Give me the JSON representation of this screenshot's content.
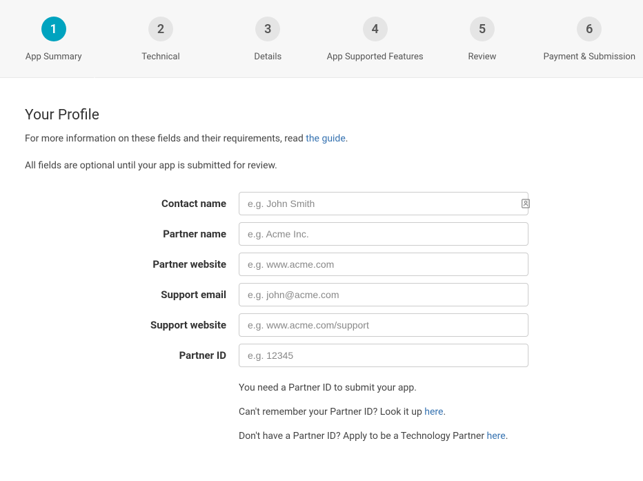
{
  "stepper": {
    "steps": [
      {
        "num": "1",
        "label": "App Summary",
        "active": true
      },
      {
        "num": "2",
        "label": "Technical",
        "active": false
      },
      {
        "num": "3",
        "label": "Details",
        "active": false
      },
      {
        "num": "4",
        "label": "App Supported Features",
        "active": false
      },
      {
        "num": "5",
        "label": "Review",
        "active": false
      },
      {
        "num": "6",
        "label": "Payment & Submission",
        "active": false
      }
    ]
  },
  "section": {
    "title": "Your Profile",
    "desc_prefix": "For more information on these fields and their requirements, read ",
    "desc_link": "the guide",
    "desc_suffix": ".",
    "note": "All fields are optional until your app is submitted for review."
  },
  "fields": {
    "contact_name": {
      "label": "Contact name",
      "placeholder": "e.g. John Smith"
    },
    "partner_name": {
      "label": "Partner name",
      "placeholder": "e.g. Acme Inc."
    },
    "partner_website": {
      "label": "Partner website",
      "placeholder": "e.g. www.acme.com"
    },
    "support_email": {
      "label": "Support email",
      "placeholder": "e.g. john@acme.com"
    },
    "support_website": {
      "label": "Support website",
      "placeholder": "e.g. www.acme.com/support"
    },
    "partner_id": {
      "label": "Partner ID",
      "placeholder": "e.g. 12345"
    }
  },
  "help": {
    "need_partner_id": "You need a Partner ID to submit your app.",
    "lookup_prefix": "Can't remember your Partner ID? Look it up ",
    "lookup_link": "here",
    "lookup_suffix": ".",
    "apply_prefix": "Don't have a Partner ID? Apply to be a Technology Partner ",
    "apply_link": "here",
    "apply_suffix": "."
  }
}
